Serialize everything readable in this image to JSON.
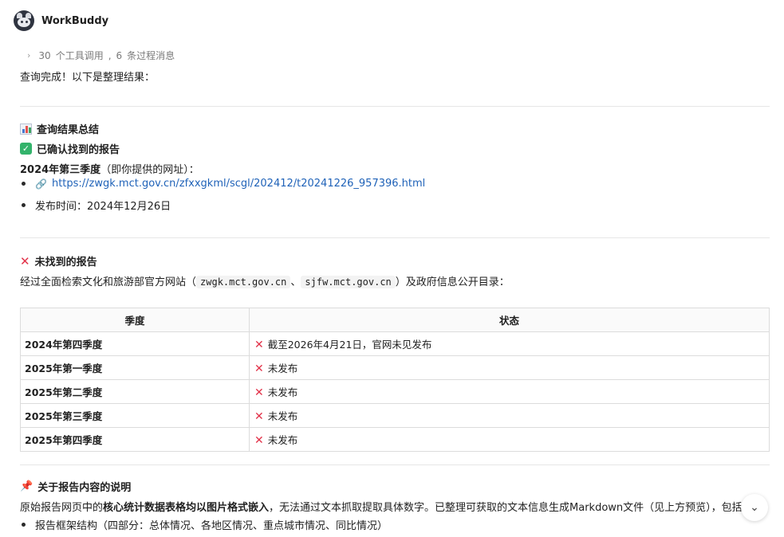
{
  "app": {
    "name": "WorkBuddy"
  },
  "tools": {
    "count": "30",
    "count_label": "个工具调用",
    "sep": ",",
    "msg_count": "6",
    "msg_label": "条过程消息"
  },
  "intro": "查询完成！以下是整理结果：",
  "summary": {
    "title": "查询结果总结"
  },
  "found": {
    "title": "已确认找到的报告",
    "report_bold": "2024年第三季度",
    "report_note": "（即你提供的网址）：",
    "url": "https://zwgk.mct.gov.cn/zfxxgkml/scgl/202412/t20241226_957396.html",
    "publish": "发布时间：2024年12月26日"
  },
  "not_found": {
    "title": "未找到的报告",
    "desc_prefix": "经过全面检索文化和旅游部官方网站（",
    "site1": "zwgk.mct.gov.cn",
    "sep": "、",
    "site2": "sjfw.mct.gov.cn",
    "desc_suffix": "）及政府信息公开目录：",
    "table": {
      "headers": [
        "季度",
        "状态"
      ],
      "rows": [
        {
          "quarter": "2024年第四季度",
          "status": "截至2026年4月21日，官网未见发布"
        },
        {
          "quarter": "2025年第一季度",
          "status": "未发布"
        },
        {
          "quarter": "2025年第二季度",
          "status": "未发布"
        },
        {
          "quarter": "2025年第三季度",
          "status": "未发布"
        },
        {
          "quarter": "2025年第四季度",
          "status": "未发布"
        }
      ]
    }
  },
  "notes": {
    "title": "关于报告内容的说明",
    "p_prefix": "原始报告网页中的",
    "p_bold": "核心统计数据表格均以图片格式嵌入",
    "p_suffix": "，无法通过文本抓取提取具体数字。已整理可获取的文本信息生成Markdown文件（见上方预览），包括：",
    "bullet1": "报告框架结构（四部分：总体情况、各地区情况、重点城市情况、同比情况）"
  },
  "icons": {
    "avatar": "raccoon-avatar-icon",
    "chevron": "chevron-right-icon",
    "chart": "bar-chart-icon",
    "check": "check-box-icon",
    "cross": "cross-mark-icon",
    "pin": "pushpin-icon",
    "link": "link-icon",
    "scroll": "chevron-down-icon"
  },
  "colors": {
    "link": "#1f62b8",
    "cross": "#e2334a",
    "check": "#33b36b"
  }
}
